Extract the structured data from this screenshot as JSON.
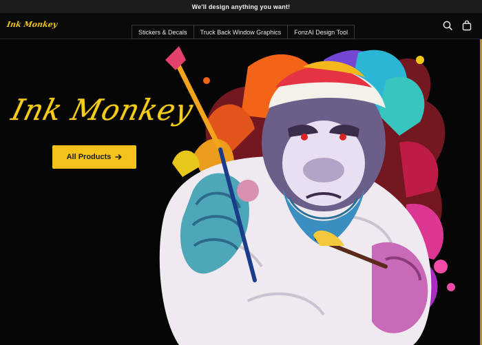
{
  "announcement": "We'll design anything you want!",
  "header": {
    "logo_text": "Ink Monkey",
    "nav": [
      {
        "label": "Stickers & Decals"
      },
      {
        "label": "Truck Back Window Graphics"
      },
      {
        "label": "FonzAI Design Tool"
      }
    ],
    "search_icon": "search-icon",
    "cart_icon": "shopping-bag-icon"
  },
  "hero": {
    "title": "Ink Monkey",
    "cta_label": "All Products",
    "cta_icon": "arrow-right-icon"
  },
  "colors": {
    "accent": "#f4c21a",
    "background": "#060606",
    "announcement_bar": "#1c1c1c"
  }
}
